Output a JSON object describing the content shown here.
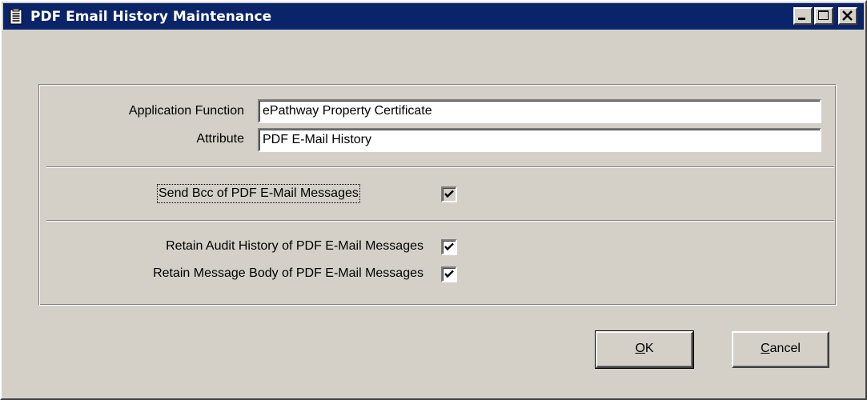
{
  "window": {
    "title": "PDF Email History Maintenance",
    "icon": "document-icon",
    "controls": {
      "minimize": "minimize-icon",
      "maximize": "maximize-icon",
      "close": "close-icon"
    }
  },
  "form": {
    "application_function": {
      "label": "Application Function",
      "value": "ePathway Property Certificate"
    },
    "attribute": {
      "label": "Attribute",
      "value": "PDF E-Mail History"
    },
    "send_bcc": {
      "label": "Send Bcc of PDF E-Mail Messages",
      "checked": true
    },
    "retain_audit": {
      "label": "Retain Audit History of PDF E-Mail Messages",
      "checked": true
    },
    "retain_body": {
      "label": "Retain Message Body of PDF E-Mail Messages",
      "checked": true
    }
  },
  "buttons": {
    "ok": {
      "label_underlined": "O",
      "label_rest": "K"
    },
    "cancel": {
      "label_underlined": "C",
      "label_rest": "ancel"
    }
  },
  "colors": {
    "titlebar": "#0a246a",
    "face": "#d4d0c8"
  }
}
